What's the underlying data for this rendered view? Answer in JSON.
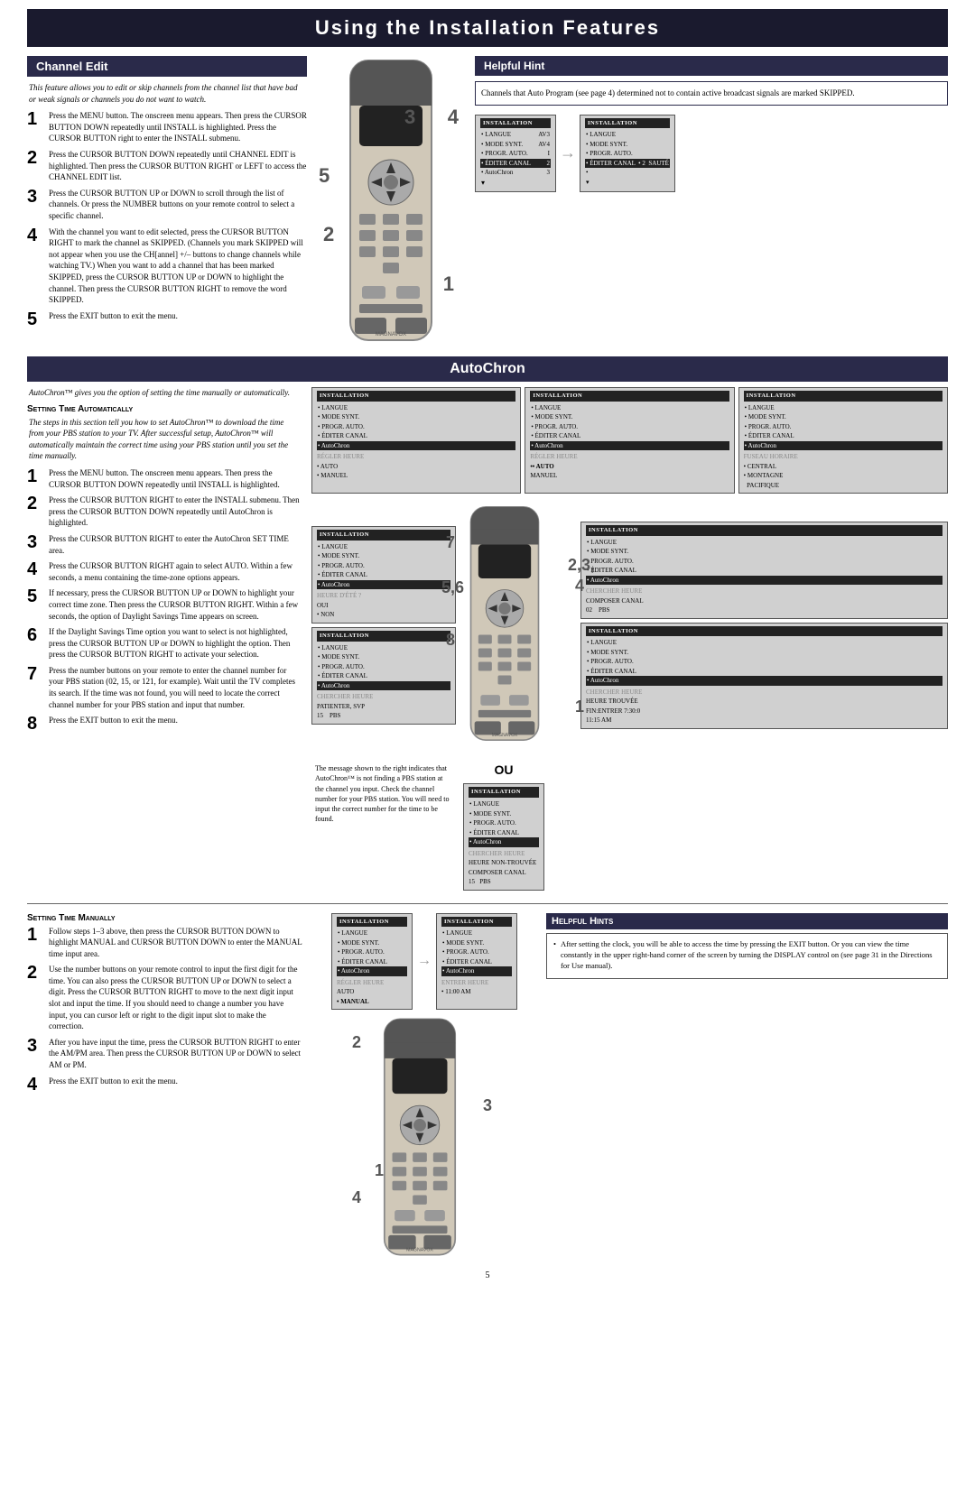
{
  "page": {
    "title": "Using the Installation Features",
    "page_number": "5"
  },
  "channel_edit": {
    "header": "Channel Edit",
    "intro": "This feature allows you to edit or skip channels from the channel list that have bad or weak signals or channels you do not want to watch.",
    "steps": [
      {
        "num": "1",
        "text": "Press the MENU button. The onscreen menu appears. Then press the CURSOR BUTTON DOWN repeatedly until INSTALL is highlighted. Press the CURSOR BUTTON right to enter the INSTALL submenu."
      },
      {
        "num": "2",
        "text": "Press the CURSOR BUTTON DOWN repeatedly until CHANNEL EDIT is highlighted. Then press the CURSOR BUTTON RIGHT or LEFT to access the CHANNEL EDIT list."
      },
      {
        "num": "3",
        "text": "Press the CURSOR BUTTON UP or DOWN to scroll through the list of channels. Or press the NUMBER buttons on your remote control to select a specific channel."
      },
      {
        "num": "4",
        "text": "With the channel you want to edit selected, press the CURSOR BUTTON RIGHT to mark the channel as SKIPPED. (Channels you mark SKIPPED will not appear when you use the CH[annel] +/– buttons to change channels while watching TV.) When you want to add a channel that has been marked SKIPPED, press the CURSOR BUTTON UP or DOWN to highlight the channel. Then press the CURSOR BUTTON RIGHT to remove the word SKIPPED."
      },
      {
        "num": "5",
        "text": "Press the EXIT button to exit the menu."
      }
    ]
  },
  "helpful_hint_top": {
    "header": "Helpful Hint",
    "text": "Channels that Auto Program (see page 4) determined not to contain active broadcast signals are marked SKIPPED."
  },
  "autochron": {
    "header": "AutoChron",
    "intro": "AutoChron™ gives you the option of setting the time manually or automatically.",
    "setting_time_auto": {
      "title": "Setting Time Automatically",
      "subtitle": "The steps in this section tell you how to set AutoChron™ to download the time from your PBS station to your TV. After successful setup, AutoChron™ will automatically maintain the correct time using your PBS station until you set the time manually."
    },
    "steps_auto": [
      {
        "num": "1",
        "text": "Press the MENU button. The onscreen menu appears. Then press the CURSOR BUTTON DOWN repeatedly until INSTALL is highlighted."
      },
      {
        "num": "2",
        "text": "Press the CURSOR BUTTON RIGHT to enter the INSTALL submenu. Then press the CURSOR BUTTON DOWN repeatedly until AutoChron is highlighted."
      },
      {
        "num": "3",
        "text": "Press the CURSOR BUTTON RIGHT to enter the AutoChron SET TIME area."
      },
      {
        "num": "4",
        "text": "Press the CURSOR BUTTON RIGHT again to select AUTO. Within a few seconds, a menu containing the time-zone options appears."
      },
      {
        "num": "5",
        "text": "If necessary, press the CURSOR BUTTON UP or DOWN to highlight your correct time zone. Then press the CURSOR BUTTON RIGHT. Within a few seconds, the option of Daylight Savings Time appears on screen."
      },
      {
        "num": "6",
        "text": "If the Daylight Savings Time option you want to select is not highlighted, press the CURSOR BUTTON UP or DOWN to highlight the option. Then press the CURSOR BUTTON RIGHT to activate your selection."
      },
      {
        "num": "7",
        "text": "Press the number buttons on your remote to enter the channel number for your PBS station (02, 15, or 121, for example). Wait until the TV completes its search. If the time was not found, you will need to locate the correct channel number for your PBS station and input that number."
      },
      {
        "num": "8",
        "text": "Press the EXIT button to exit the menu."
      }
    ],
    "message_text": "The message shown to the right indicates that AutoChron™ is not finding a PBS station at the channel you input. Check the channel number for your PBS station. You will need to input the correct number for the time to be found.",
    "ou_label": "OU",
    "setting_time_manually": {
      "title": "Setting Time Manually",
      "steps": [
        {
          "num": "1",
          "text": "Follow steps 1–3 above, then press the CURSOR BUTTON DOWN to highlight MANUAL and CURSOR BUTTON DOWN to enter the MANUAL time input area."
        },
        {
          "num": "2",
          "text": "Use the number buttons on your remote control to input the first digit for the time. You can also press the CURSOR BUTTON UP or DOWN to select a digit. Press the CURSOR BUTTON RIGHT to move to the next digit input slot and input the time. If you should need to change a number you have input, you can cursor left or right to the digit input slot to make the correction."
        },
        {
          "num": "3",
          "text": "After you have input the time, press the CURSOR BUTTON RIGHT to enter the AM/PM area. Then press the CURSOR BUTTON UP or DOWN to select AM or PM."
        },
        {
          "num": "4",
          "text": "Press the EXIT button to exit the menu."
        }
      ]
    }
  },
  "helpful_hints_bottom": {
    "header": "Helpful Hints",
    "items": [
      "After setting the clock, you will be able to access the time by pressing the EXIT button. Or you can view the time constantly in the upper right-hand corner of the screen by turning the DISPLAY control on (see page 31 in the Directions for Use manual)."
    ]
  },
  "screens": {
    "top": [
      {
        "title": "INSTALLATION",
        "items": [
          "• LANGUE",
          "• MODE SYNT.",
          "• PROGR. AUTO.",
          "• ÉDITER CANAL",
          "• AutoChron"
        ],
        "values": [
          "",
          "",
          "I",
          "2",
          "3"
        ],
        "highlight_index": -1,
        "extra": "AV3\nAV4"
      },
      {
        "title": "INSTALLATION",
        "items": [
          "• LANGUE",
          "• MODE SYNT.",
          "• PROGR. AUTO.",
          "• ÉDITER CANAL",
          "•"
        ],
        "values": [
          "",
          "",
          "",
          "",
          ""
        ],
        "highlight_index": 3,
        "extra": "AV3\nAV4",
        "highlight_label": "ÉDITER CANAL",
        "right_label": "• 2  SAUTÉ"
      }
    ],
    "autochron_screens": [
      {
        "title": "INSTALLATION",
        "items": [
          "• LANGUE",
          "• MODE SYNT.",
          "• PROGR. AUTO.",
          "• ÉDITER CANAL",
          "• AutoChron"
        ],
        "right_label": "RÉGLER HEURE",
        "sub_items": [
          "• AUTO",
          "• MANUEL"
        ]
      },
      {
        "title": "INSTALLATION",
        "items": [
          "• LANGUE",
          "• MODE SYNT.",
          "• PROGR. AUTO.",
          "• ÉDITER CANAL",
          "• AutoChron"
        ],
        "right_label": "RÉGLER HEURE",
        "sub_items": [
          "•• AUTO",
          "MANUEL"
        ]
      },
      {
        "title": "INSTALLATION",
        "items": [
          "• LANGUE",
          "• MODE SYNT.",
          "• PROGR. AUTO.",
          "• ÉDITER CANAL",
          "• AutoChron"
        ],
        "right_label": "FUSEAU HORAIRE",
        "sub_items": [
          "• CENTRAL",
          "• MONTAGNE",
          "  PACIFIQUE"
        ]
      },
      {
        "title": "INSTALLATION",
        "items": [
          "• LANGUE",
          "• MODE SYNT.",
          "• PROGR. AUTO.",
          "• ÉDITER CANAL",
          "• AutoChron"
        ],
        "right_label": "HEURE D'ÉTÉ ?",
        "sub_items": [
          "OUI",
          "• NON"
        ]
      },
      {
        "title": "INSTALLATION",
        "items": [
          "• LANGUE",
          "• MODE SYNT.",
          "• PROGR. AUTO.",
          "• ÉDITER CANAL",
          "• AutoChron"
        ],
        "right_label": "CHERCHER\nHEURE",
        "sub_items": [
          "COMPOSER CANAL",
          "02   PBS"
        ]
      },
      {
        "title": "INSTALLATION",
        "items": [
          "• LANGUE",
          "• MODE SYNT.",
          "• PROGR. AUTO.",
          "• ÉDITER CANAL",
          "• AutoChron"
        ],
        "right_label": "CHERCHER\nHEURE",
        "sub_items": [
          "PATIENTER, SVP",
          "15   PBS"
        ]
      },
      {
        "title": "INSTALLATION",
        "items": [
          "• LANGUE",
          "• MODE SYNT.",
          "• PROGR. AUTO.",
          "• ÉDITER CANAL",
          "• AutoChron"
        ],
        "right_label": "CHERCHER\nHEURE",
        "sub_items": [
          "HEURE TROUVÉE",
          "FIN:ENTRER 7:30:0",
          "11:15 AM"
        ]
      },
      {
        "title": "INSTALLATION",
        "items": [
          "• LANGUE",
          "• MODE SYNT.",
          "• PROGR. AUTO.",
          "• ÉDITER CANAL",
          "• AutoChron"
        ],
        "right_label": "CHERCHER\nHEURE",
        "sub_items": [
          "HEURE NON-TROUVÉE",
          "COMPOSER CANAL",
          "15   PBS"
        ]
      }
    ],
    "manual_screens": [
      {
        "title": "INSTALLATION",
        "items": [
          "• LANGUE",
          "• MODE SYNT.",
          "• PROGR. AUTO.",
          "• ÉDITER CANAL",
          "• AutoChron"
        ],
        "right_label": "RÉGLER HEURE",
        "sub_items": [
          "AUTO",
          "• MANUAL"
        ]
      },
      {
        "title": "INSTALLATION",
        "items": [
          "• LANGUE",
          "• MODE SYNT.",
          "• PROGR. AUTO.",
          "• ÉDITER CANAL",
          "• AutoChron"
        ],
        "right_label": "ENTRER HEURE",
        "sub_items": [
          "• 11:00 AM"
        ]
      }
    ]
  }
}
